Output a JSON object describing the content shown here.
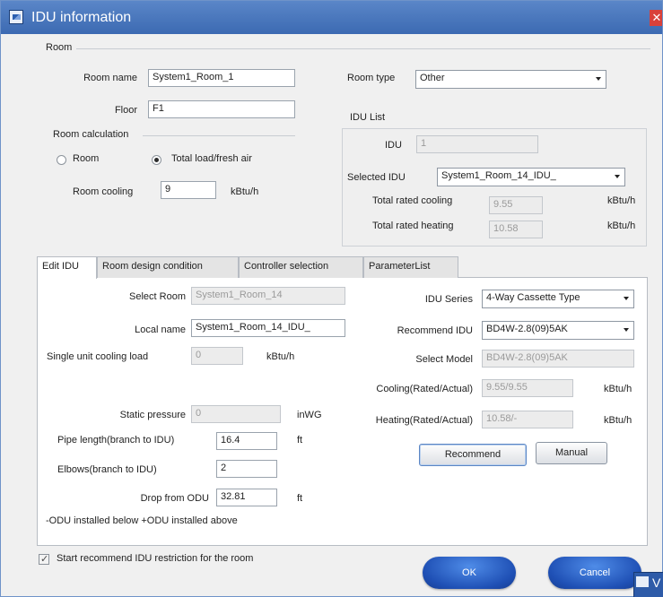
{
  "window": {
    "title": "IDU information"
  },
  "room": {
    "group_label": "Room",
    "name_label": "Room name",
    "name_value": "System1_Room_1",
    "floor_label": "Floor",
    "floor_value": "F1",
    "type_label": "Room type",
    "type_value": "Other"
  },
  "calc": {
    "group_label": "Room calculation",
    "option_room": "Room",
    "option_total": "Total load/fresh air",
    "selected": "Total load/fresh air",
    "cooling_label": "Room cooling",
    "cooling_value": "9",
    "cooling_unit": "kBtu/h"
  },
  "idu_list": {
    "group_label": "IDU List",
    "idu_label": "IDU",
    "idu_value": "1",
    "selected_label": "Selected IDU",
    "selected_value": "System1_Room_14_IDU_",
    "total_cooling_label": "Total rated cooling",
    "total_cooling_value": "9.55",
    "total_cooling_unit": "kBtu/h",
    "total_heating_label": "Total rated heating",
    "total_heating_value": "10.58",
    "total_heating_unit": "kBtu/h"
  },
  "tabs": [
    {
      "label": "Edit IDU",
      "active": true
    },
    {
      "label": "Room design condition",
      "active": false
    },
    {
      "label": "Controller selection",
      "active": false
    },
    {
      "label": "ParameterList",
      "active": false
    }
  ],
  "edit": {
    "select_room_label": "Select Room",
    "select_room_value": "System1_Room_14",
    "local_name_label": "Local name",
    "local_name_value": "System1_Room_14_IDU_",
    "single_load_label": "Single unit cooling load",
    "single_load_value": "0",
    "single_load_unit": "kBtu/h",
    "static_pressure_label": "Static pressure",
    "static_pressure_value": "0",
    "static_pressure_unit": "inWG",
    "pipe_length_label": "Pipe length(branch to IDU)",
    "pipe_length_value": "16.4",
    "pipe_length_unit": "ft",
    "elbows_label": "Elbows(branch to IDU)",
    "elbows_value": "2",
    "drop_label": "Drop from ODU",
    "drop_value": "32.81",
    "drop_unit": "ft",
    "note": "-ODU installed below +ODU installed above",
    "series_label": "IDU Series",
    "series_value": "4-Way Cassette Type",
    "recommend_label": "Recommend IDU",
    "recommend_value": "BD4W-2.8(09)5AK",
    "model_label": "Select Model",
    "model_value": "BD4W-2.8(09)5AK",
    "cooling_label": "Cooling(Rated/Actual)",
    "cooling_value": "9.55/9.55",
    "cooling_unit": "kBtu/h",
    "heating_label": "Heating(Rated/Actual)",
    "heating_value": "10.58/-",
    "heating_unit": "kBtu/h",
    "recommend_button": "Recommend",
    "manual_button": "Manual"
  },
  "footer": {
    "restriction_label": "Start recommend IDU restriction for the room",
    "restriction_checked": true,
    "ok_button": "OK",
    "cancel_button": "Cancel"
  },
  "overlay_window": {
    "title_fragment": "V"
  }
}
